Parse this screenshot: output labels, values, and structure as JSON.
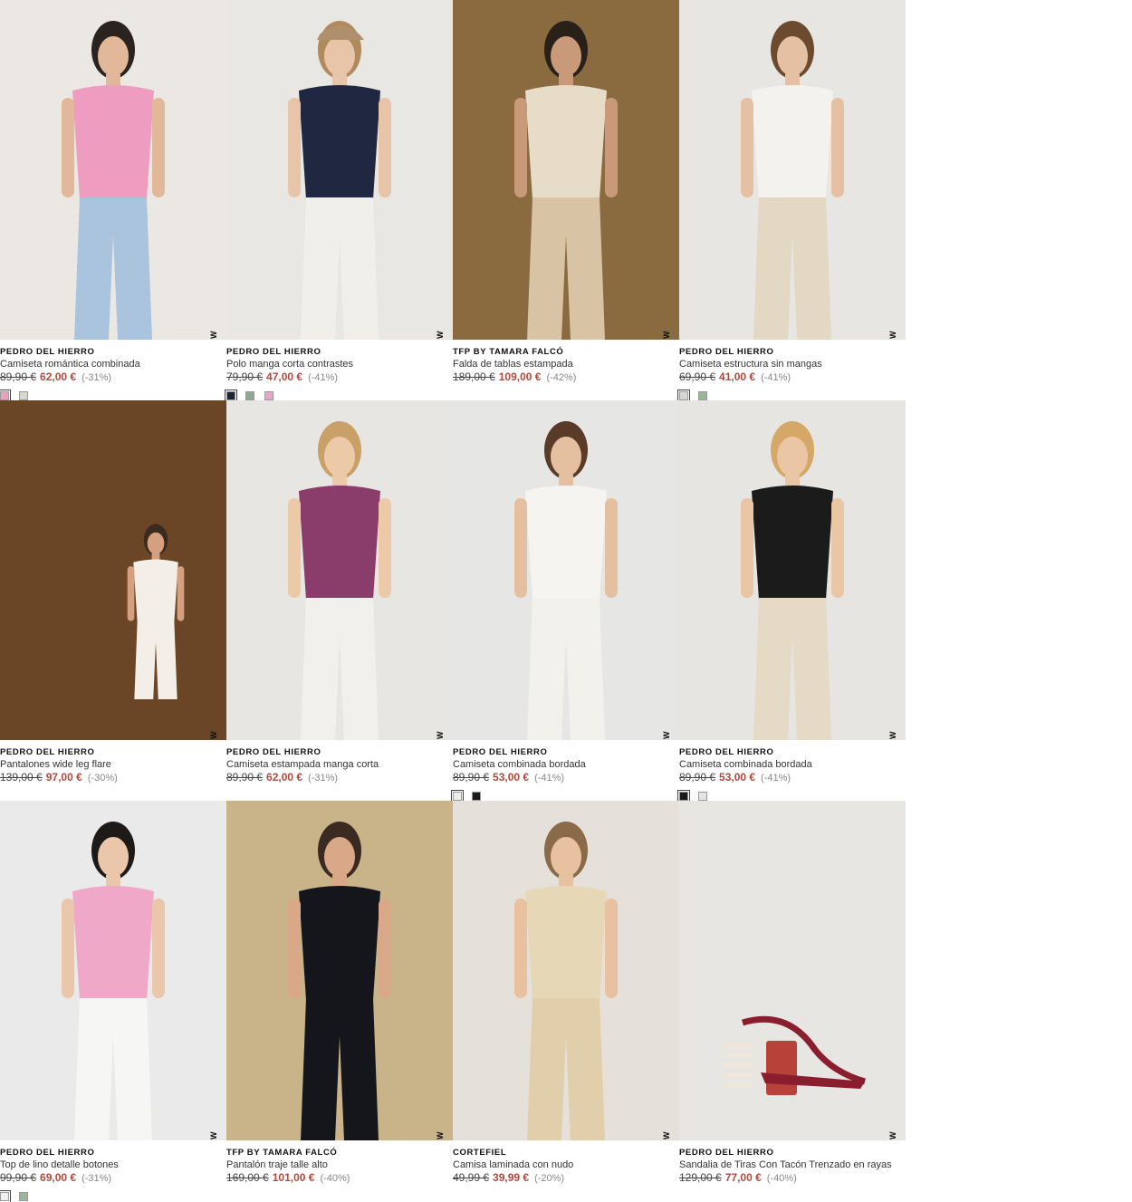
{
  "new_badge": "NEW",
  "products": [
    {
      "brand": "PEDRO DEL HIERRO",
      "name": "Camiseta romántica combinada",
      "old": "89,90 €",
      "price": "62,00 €",
      "discount": "(-31%)",
      "new": true,
      "bg": "#ebe8e3",
      "swatches": [
        "#e8a4b8",
        "#d8d8d0"
      ]
    },
    {
      "brand": "PEDRO DEL HIERRO",
      "name": "Polo manga corta contrastes",
      "old": "79,90 €",
      "price": "47,00 €",
      "discount": "(-41%)",
      "new": true,
      "bg": "#e9e7e3",
      "swatches": [
        "#1e2535",
        "#8fa88f",
        "#e6a8c6"
      ]
    },
    {
      "brand": "TFP BY TAMARA FALCÓ",
      "name": "Falda de tablas estampada",
      "old": "189,00 €",
      "price": "109,00 €",
      "discount": "(-42%)",
      "new": true,
      "bg": "#8a6a3f",
      "swatches": []
    },
    {
      "brand": "PEDRO DEL HIERRO",
      "name": "Camiseta estructura sin mangas",
      "old": "69,90 €",
      "price": "41,00 €",
      "discount": "(-41%)",
      "new": true,
      "bg": "#e7e6e3",
      "swatches": [
        "#d6d6d2",
        "#9cb69a"
      ]
    },
    {
      "brand": "PEDRO DEL HIERRO",
      "name": "Pantalones wide leg flare",
      "old": "139,00 €",
      "price": "97,00 €",
      "discount": "(-30%)",
      "new": true,
      "bg": "#6a4526",
      "swatches": []
    },
    {
      "brand": "PEDRO DEL HIERRO",
      "name": "Camiseta estampada manga corta",
      "old": "89,90 €",
      "price": "62,00 €",
      "discount": "(-31%)",
      "new": true,
      "bg": "#e8e6e2",
      "swatches": []
    },
    {
      "brand": "PEDRO DEL HIERRO",
      "name": "Camiseta combinada bordada",
      "old": "89,90 €",
      "price": "53,00 €",
      "discount": "(-41%)",
      "new": true,
      "bg": "#e6e6e4",
      "swatches": [
        "#ececea",
        "#1a1a1a"
      ]
    },
    {
      "brand": "PEDRO DEL HIERRO",
      "name": "Camiseta combinada bordada",
      "old": "89,90 €",
      "price": "53,00 €",
      "discount": "(-41%)",
      "new": true,
      "bg": "#e6e5e2",
      "swatches": [
        "#1a1a1a",
        "#e4e4e2"
      ]
    },
    {
      "brand": "PEDRO DEL HIERRO",
      "name": "Top de lino detalle botones",
      "old": "99,90 €",
      "price": "69,00 €",
      "discount": "(-31%)",
      "new": true,
      "bg": "#eaeaea",
      "swatches": [
        "#f0f0ee",
        "#9cb69a"
      ]
    },
    {
      "brand": "TFP BY TAMARA FALCÓ",
      "name": "Pantalón traje talle alto",
      "old": "169,00 €",
      "price": "101,00 €",
      "discount": "(-40%)",
      "new": true,
      "bg": "#c9b48a",
      "swatches": []
    },
    {
      "brand": "CORTEFIEL",
      "name": "Camisa laminada con nudo",
      "old": "49,99 €",
      "price": "39,99 €",
      "discount": "(-20%)",
      "new": true,
      "bg": "#e5e1da",
      "swatches": []
    },
    {
      "brand": "PEDRO DEL HIERRO",
      "name": "Sandalia de Tiras Con Tacón Trenzado en rayas",
      "old": "129,00 €",
      "price": "77,00 €",
      "discount": "(-40%)",
      "new": true,
      "bg": "#e7e6e3",
      "swatches": []
    }
  ]
}
